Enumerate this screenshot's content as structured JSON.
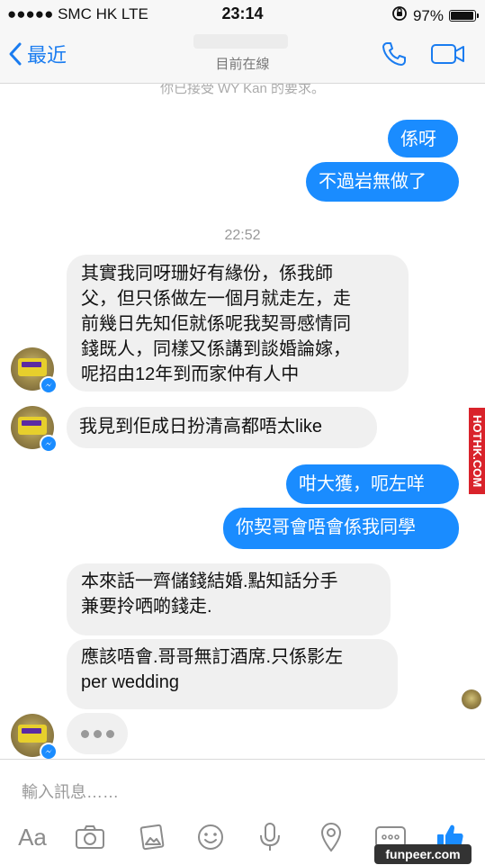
{
  "status_bar": {
    "carrier": "●●●●● SMC HK  LTE",
    "time": "23:14",
    "battery": "97%",
    "battery_level": 0.97
  },
  "nav": {
    "back_label": "最近",
    "subtitle": "目前在線"
  },
  "chat": {
    "system_note": "你已接受 WY Kan 的要求。",
    "timestamp": "22:52",
    "messages": [
      {
        "from": "me",
        "text": "係呀"
      },
      {
        "from": "me",
        "text": "不過岩無做了"
      },
      {
        "from": "them",
        "lines": [
          "其實我同呀珊好有緣份，係我師",
          "父，但只係做左一個月就走左，走",
          "前幾日先知佢就係呢我契哥感情同",
          "錢既人，同樣又係講到談婚論嫁，",
          "呢招由12年到而家仲有人中"
        ]
      },
      {
        "from": "them",
        "text": "我見到佢成日扮清高都唔太like"
      },
      {
        "from": "me",
        "text": "咁大獲，呃左咩"
      },
      {
        "from": "me",
        "text": "你契哥會唔會係我同學"
      },
      {
        "from": "them",
        "lines": [
          "本來話一齊儲錢結婚.點知話分手",
          "兼要拎哂啲錢走."
        ]
      },
      {
        "from": "them",
        "lines": [
          "應該唔會.哥哥無訂酒席.只係影左",
          "per wedding"
        ]
      }
    ]
  },
  "watermark": "HOTHK.COM",
  "input": {
    "placeholder": "輸入訊息……",
    "aa_label": "Aa"
  },
  "footer_watermark": "funpeer.com",
  "colors": {
    "outgoing_bubble": "#1a8cff",
    "incoming_bubble": "#f0f0f0",
    "accent": "#1a7cf0"
  }
}
